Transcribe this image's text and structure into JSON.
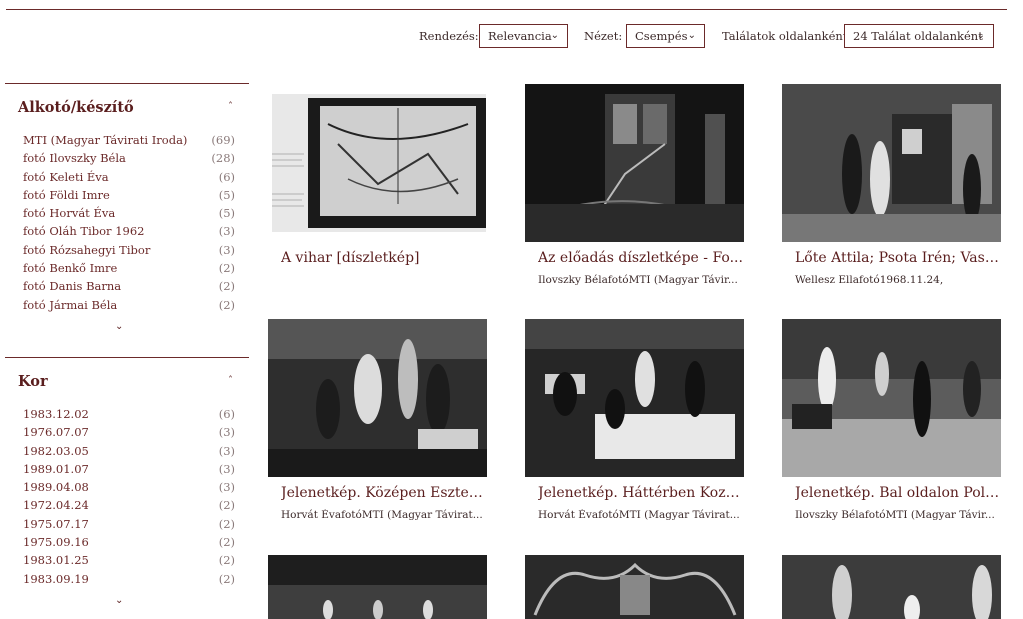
{
  "toolbar": {
    "sort_label": "Rendezés:",
    "sort_value": "Relevancia",
    "view_label": "Nézet:",
    "view_value": "Csempés",
    "per_page_label": "Találatok oldalanként:",
    "per_page_value": "24 Találat oldalanként"
  },
  "facets": [
    {
      "title": "Alkotó/készítő",
      "items": [
        {
          "label": "MTI (Magyar Távirati Iroda)",
          "count": "(69)"
        },
        {
          "label": "fotó Ilovszky Béla",
          "count": "(28)"
        },
        {
          "label": "fotó Keleti Éva",
          "count": "(6)"
        },
        {
          "label": "fotó Földi Imre",
          "count": "(5)"
        },
        {
          "label": "fotó Horvát Éva",
          "count": "(5)"
        },
        {
          "label": "fotó Oláh Tibor 1962",
          "count": "(3)"
        },
        {
          "label": "fotó Rózsahegyi Tibor",
          "count": "(3)"
        },
        {
          "label": "fotó Benkő Imre",
          "count": "(2)"
        },
        {
          "label": "fotó Danis Barna",
          "count": "(2)"
        },
        {
          "label": "fotó Jármai Béla",
          "count": "(2)"
        }
      ]
    },
    {
      "title": "Kor",
      "items": [
        {
          "label": "1983.12.02",
          "count": "(6)"
        },
        {
          "label": "1976.07.07",
          "count": "(3)"
        },
        {
          "label": "1982.03.05",
          "count": "(3)"
        },
        {
          "label": "1989.01.07",
          "count": "(3)"
        },
        {
          "label": "1989.04.08",
          "count": "(3)"
        },
        {
          "label": "1972.04.24",
          "count": "(2)"
        },
        {
          "label": "1975.07.17",
          "count": "(2)"
        },
        {
          "label": "1975.09.16",
          "count": "(2)"
        },
        {
          "label": "1983.01.25",
          "count": "(2)"
        },
        {
          "label": "1983.09.19",
          "count": "(2)"
        }
      ]
    }
  ],
  "results": [
    {
      "title": "A vihar [díszletkép]",
      "subtitle": ""
    },
    {
      "title": "Az előadás díszletképe - Fo...",
      "subtitle": "Ilovszky BélafotóMTI (Magyar Távir..."
    },
    {
      "title": "Lőte Attila; Psota Irén; Vass...",
      "subtitle": "Wellesz Ellafotó1968.11.24,"
    },
    {
      "title": "Jelenetkép. Középen Eszter...",
      "subtitle": "Horvát ÉvafotóMTI (Magyar Távirat..."
    },
    {
      "title": "Jelenetkép. Háttérben Kozá...",
      "subtitle": "Horvát ÉvafotóMTI (Magyar Távirat..."
    },
    {
      "title": "Jelenetkép. Bal oldalon Polg...",
      "subtitle": "Ilovszky BélafotóMTI (Magyar Távir..."
    },
    {
      "title": "",
      "subtitle": ""
    },
    {
      "title": "",
      "subtitle": ""
    },
    {
      "title": "",
      "subtitle": ""
    }
  ],
  "icons": {
    "dropdown": "chevron-down-icon",
    "collapse": "chevron-double-up-icon",
    "expand": "chevron-down-icon"
  }
}
